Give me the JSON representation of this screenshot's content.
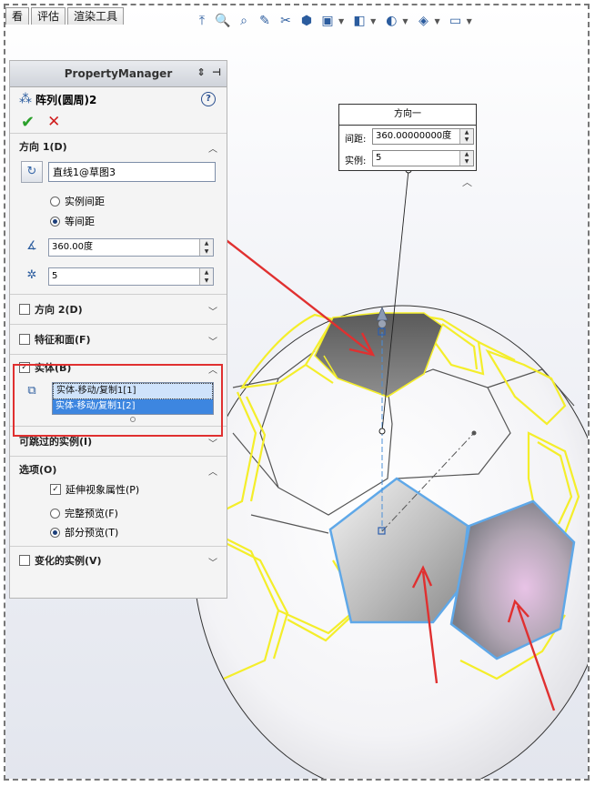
{
  "menu": {
    "tabs": [
      "看",
      "评估",
      "渲染工具"
    ]
  },
  "hud_icons": [
    "view-orientation-icon",
    "zoom-fit-icon",
    "zoom-area-icon",
    "previous-view-icon",
    "section-view-icon",
    "dynamic-annotation-icon",
    "view-cube-icon",
    "display-style-icon",
    "hide-show-icon",
    "edit-appearance-icon",
    "apply-scene-icon",
    "view-settings-icon",
    "monitor-icon"
  ],
  "property_manager": {
    "header": "PropertyManager",
    "feature_title": "阵列(圆周)2",
    "help": "?",
    "ok": "✔",
    "cancel": "✕",
    "direction1": {
      "title": "方向 1(D)",
      "axis_value": "直线1@草图3",
      "option_instance_spacing": "实例间距",
      "option_equal_spacing": "等间距",
      "angle_value": "360.00度",
      "instances_value": "5"
    },
    "direction2": {
      "title": "方向 2(D)"
    },
    "features_faces": {
      "title": "特征和面(F)"
    },
    "bodies": {
      "title": "实体(B)",
      "items": [
        "实体-移动/复制1[1]",
        "实体-移动/复制1[2]"
      ]
    },
    "skip_instances": {
      "title": "可跳过的实例(I)"
    },
    "options": {
      "title": "选项(O)",
      "propagate_visual": "延伸视象属性(P)",
      "full_preview": "完整预览(F)",
      "partial_preview": "部分预览(T)"
    },
    "varied_instances": {
      "title": "变化的实例(V)"
    }
  },
  "callout": {
    "title": "方向一",
    "spacing_label": "间距:",
    "spacing_value": "360.00000000度",
    "instances_label": "实例:",
    "instances_value": "5"
  },
  "colors": {
    "preview_yellow": "#f4ee2a",
    "selection_blue": "#5fa8e8",
    "annotation_red": "#e03030",
    "pentagon_gray": "#8a8a8a"
  }
}
